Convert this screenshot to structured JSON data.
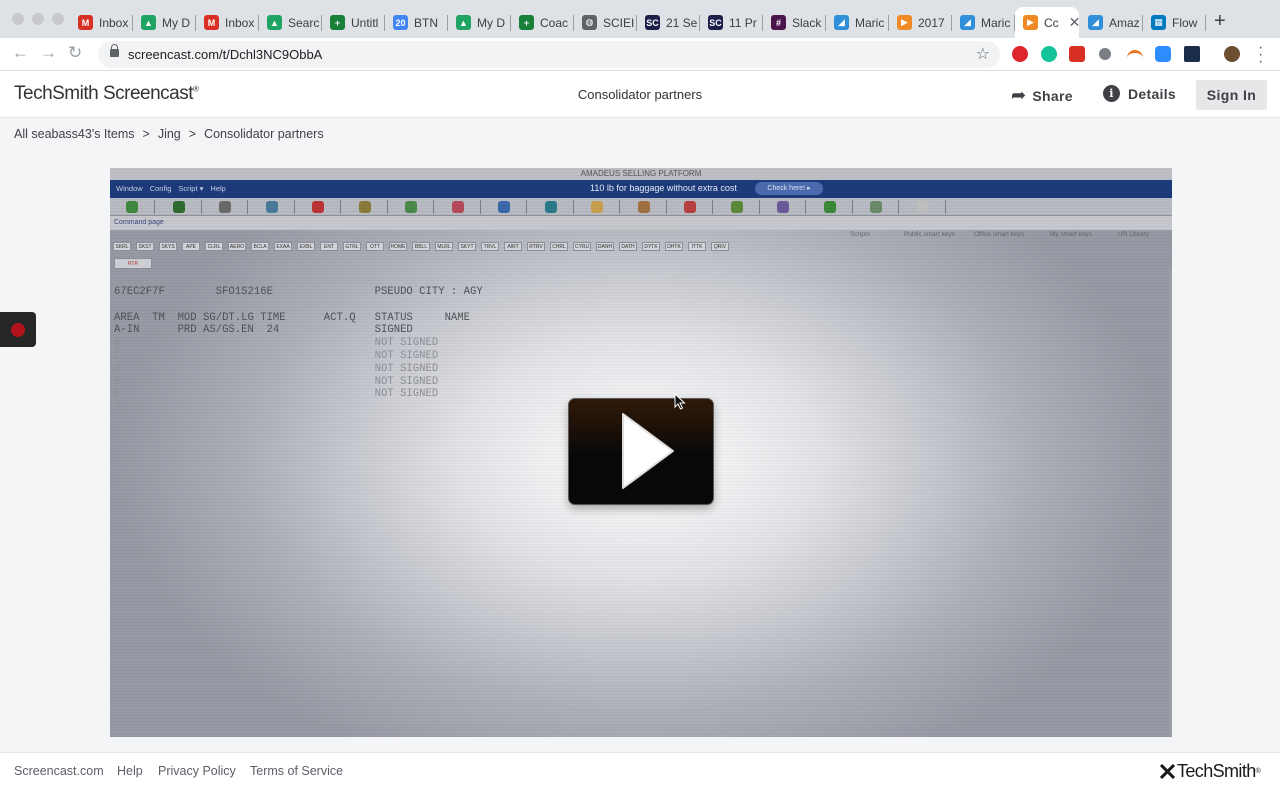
{
  "browser": {
    "tabs": [
      {
        "label": "Inbox",
        "icon": "gmail-icon",
        "color": "#d93025",
        "glyph": "M"
      },
      {
        "label": "My D",
        "icon": "drive-icon",
        "color": "#1fa463",
        "glyph": "▲"
      },
      {
        "label": "Inbox",
        "icon": "gmail-icon",
        "color": "#d93025",
        "glyph": "M"
      },
      {
        "label": "Searc",
        "icon": "drive-icon",
        "color": "#1fa463",
        "glyph": "▲"
      },
      {
        "label": "Untitl",
        "icon": "sheets-icon",
        "color": "#188038",
        "glyph": "+"
      },
      {
        "label": "BTN",
        "icon": "calendar-icon",
        "color": "#4285f4",
        "glyph": "20"
      },
      {
        "label": "My D",
        "icon": "drive-icon",
        "color": "#1fa463",
        "glyph": "▲"
      },
      {
        "label": "Coac",
        "icon": "sheets-icon",
        "color": "#188038",
        "glyph": "+"
      },
      {
        "label": "SCIEI",
        "icon": "globe-icon",
        "color": "#5f6368",
        "glyph": "◍"
      },
      {
        "label": "21 Se",
        "icon": "sc-icon",
        "color": "#1c1f4a",
        "glyph": "SC"
      },
      {
        "label": "11 Pr",
        "icon": "sc-icon",
        "color": "#1c1f4a",
        "glyph": "SC"
      },
      {
        "label": "Slack",
        "icon": "slack-icon",
        "color": "#4a154b",
        "glyph": "#"
      },
      {
        "label": "Maric",
        "icon": "feather-icon",
        "color": "#2f8fd8",
        "glyph": "◢"
      },
      {
        "label": "2017",
        "icon": "play-icon",
        "color": "#f08a24",
        "glyph": "▶"
      },
      {
        "label": "Maric",
        "icon": "feather-icon",
        "color": "#2f8fd8",
        "glyph": "◢"
      },
      {
        "label": "Cc",
        "icon": "screencast-icon",
        "color": "#f08a24",
        "glyph": "▶",
        "active": true
      },
      {
        "label": "Amaz",
        "icon": "feather-icon",
        "color": "#2f8fd8",
        "glyph": "◢"
      },
      {
        "label": "Flow",
        "icon": "trello-icon",
        "color": "#0079bf",
        "glyph": "▦"
      }
    ],
    "url": "screencast.com/t/Dchl3NC9ObbA"
  },
  "header": {
    "logo": "TechSmith Screencast",
    "logo_mark": "®",
    "title": "Consolidator partners",
    "share": "Share",
    "details": "Details",
    "sign_in": "Sign In"
  },
  "breadcrumb": [
    "All seabass43's Items",
    ">",
    "Jing",
    ">",
    "Consolidator partners"
  ],
  "video": {
    "app_title": "AMADEUS SELLING PLATFORM",
    "menus": [
      "Window",
      "Config",
      "Script ▾",
      "Help"
    ],
    "promo": "110 lb for baggage without extra cost",
    "promo_button": "Check here! ▸",
    "command_page": "Command page",
    "smart_tabs": [
      "Scripts",
      "Public smart keys",
      "Office smart keys",
      "My smart keys",
      "UR Library"
    ],
    "keys": [
      "SKRL",
      "SKST",
      "SKYS",
      "APE",
      "CLRL",
      "AERO",
      "BCLA",
      "EXAA",
      "EXBL",
      "ENT",
      "GTRL",
      "OTT",
      "HOME",
      "BBLL",
      "MLRL",
      "SKYT",
      "TRVL",
      "AIRT",
      "RTRV",
      "CHRL",
      "CYRU",
      "DANH",
      "DATH",
      "DYTK",
      "DHTK",
      "ITTK",
      "QRIV"
    ],
    "subtab": "RTR",
    "terminal": {
      "line1": "67EC2F7F        SFO1S216E                PSEUDO CITY : AGY",
      "header": "AREA  TM  MOD SG/DT.LG TIME      ACT.Q   STATUS     NAME",
      "row_a": "A-IN      PRD AS/GS.EN  24               SIGNED",
      "row_b": "B                                        NOT SIGNED",
      "row_c": "C                                        NOT SIGNED",
      "row_d": "D                                        NOT SIGNED",
      "row_e": "E                                        NOT SIGNED",
      "row_f": "F                                        NOT SIGNED",
      "prompt": ">"
    }
  },
  "footer": {
    "links": [
      "Screencast.com",
      "Help",
      "Privacy Policy",
      "Terms of Service"
    ],
    "brand": "TechSmith",
    "brand_mark": "®"
  },
  "colors": {
    "menubar": "#1d3a7a",
    "signin_bg": "#e6e7e8",
    "rec": "#b3141b"
  }
}
